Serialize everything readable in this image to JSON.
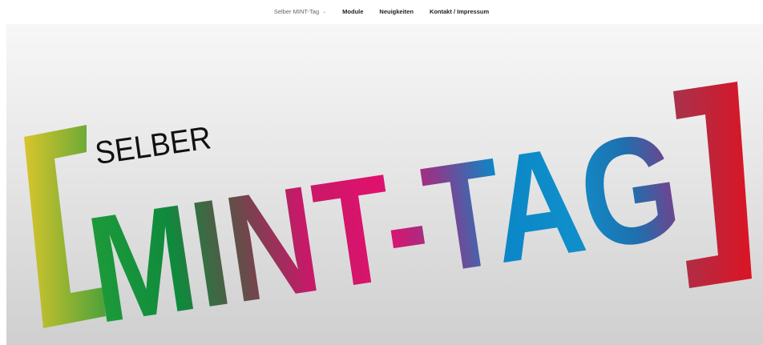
{
  "nav": {
    "items": [
      {
        "label": "Selber MINT-Tag",
        "has_dropdown": true,
        "active": true
      },
      {
        "label": "Module"
      },
      {
        "label": "Neuigkeiten"
      },
      {
        "label": "Kontakt / Impressum"
      }
    ],
    "dropdown_icon": "chevron-down-icon"
  },
  "hero": {
    "logo_small": "SELBER",
    "logo_main": "MINT-TAG",
    "bracket_left_color": "#d6c22a",
    "bracket_right_color": "#d8182f",
    "gradient_colors": [
      "#e8d82a",
      "#2aa033",
      "#0f8a3d",
      "#b21a6c",
      "#e0116d",
      "#0b87c7",
      "#cf1630"
    ]
  }
}
